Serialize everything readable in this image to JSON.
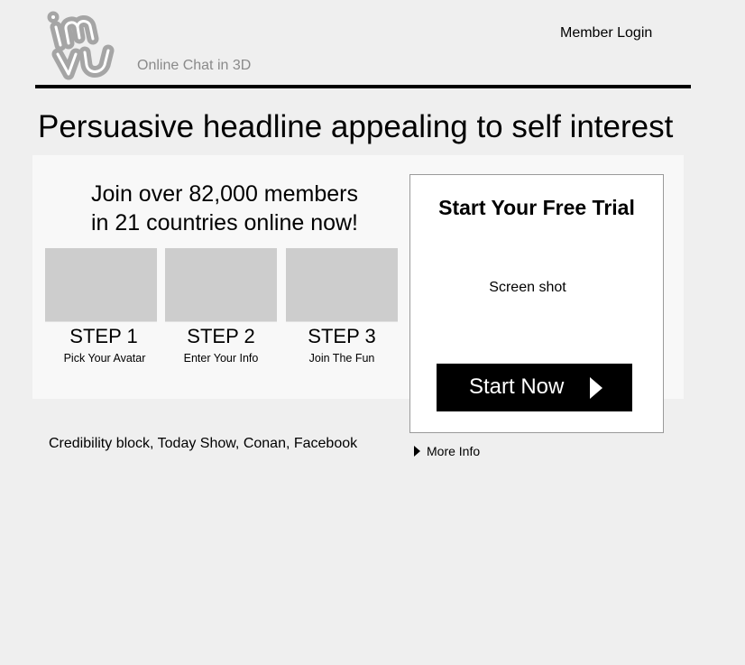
{
  "header": {
    "logo_text": "imvu",
    "tagline": "Online Chat in 3D",
    "member_login": "Member Login"
  },
  "headline": "Persuasive headline appealing to self interest",
  "join": {
    "line1": "Join over 82,000 members",
    "line2": "in 21 countries online now!"
  },
  "steps": [
    {
      "title": "STEP 1",
      "subtitle": "Pick Your Avatar"
    },
    {
      "title": "STEP 2",
      "subtitle": "Enter Your Info"
    },
    {
      "title": "STEP 3",
      "subtitle": "Join The Fun"
    }
  ],
  "trial": {
    "title": "Start Your Free Trial",
    "screenshot_label": "Screen shot",
    "button_label": "Start Now"
  },
  "credibility": "Credibility block, Today Show, Conan, Facebook",
  "more_info": "More Info",
  "colors": {
    "background": "#efefef",
    "panel": "#f8f8f8",
    "placeholder": "#cdcdcd",
    "logo": "#a5a5a5",
    "tagline": "#8a8a8a",
    "button": "#000000"
  }
}
